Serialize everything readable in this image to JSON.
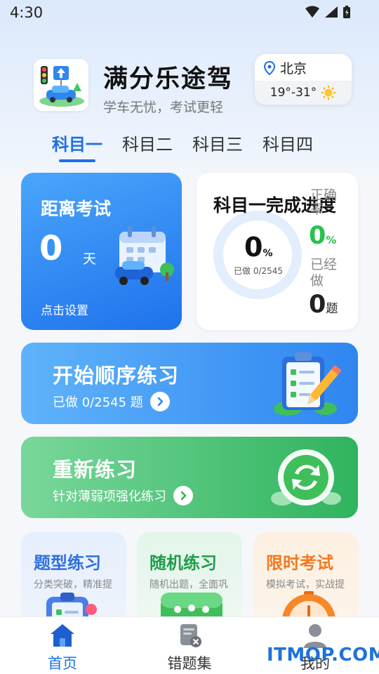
{
  "status_bar": {
    "time": "4:30"
  },
  "header": {
    "app_name": "满分乐途驾",
    "slogan": "学车无忧，考试更轻"
  },
  "weather": {
    "city": "北京",
    "temp": "19°-31°"
  },
  "tabs": [
    {
      "label": "科目一",
      "active": true
    },
    {
      "label": "科目二",
      "active": false
    },
    {
      "label": "科目三",
      "active": false
    },
    {
      "label": "科目四",
      "active": false
    }
  ],
  "exam_card": {
    "title": "距离考试",
    "days": "0",
    "unit": "天",
    "action": "点击设置"
  },
  "progress_card": {
    "title": "科目一完成进度",
    "percent": "0",
    "percent_unit": "%",
    "done_text": "已做 0/2545",
    "accuracy_label": "正确率",
    "accuracy_value": "0",
    "accuracy_unit": "%",
    "done_label": "已经做",
    "done_value": "0",
    "done_unit": "题"
  },
  "sequence_card": {
    "title": "开始顺序练习",
    "subtitle": "已做 0/2545 题"
  },
  "retry_card": {
    "title": "重新练习",
    "subtitle": "针对薄弱项强化练习"
  },
  "mini_cards": [
    {
      "title": "题型练习",
      "subtitle": "分类突破，精准提"
    },
    {
      "title": "随机练习",
      "subtitle": "随机出题，全面巩"
    },
    {
      "title": "限时考试",
      "subtitle": "模拟考试，实战提"
    }
  ],
  "bottom_nav": [
    {
      "label": "首页",
      "active": true
    },
    {
      "label": "错题集",
      "active": false
    },
    {
      "label": "我的",
      "active": false
    }
  ],
  "watermark": "ITMOP.COM",
  "colors": {
    "primary": "#1e6fe6",
    "accent_green": "#27c24c",
    "orange": "#f07a22"
  }
}
